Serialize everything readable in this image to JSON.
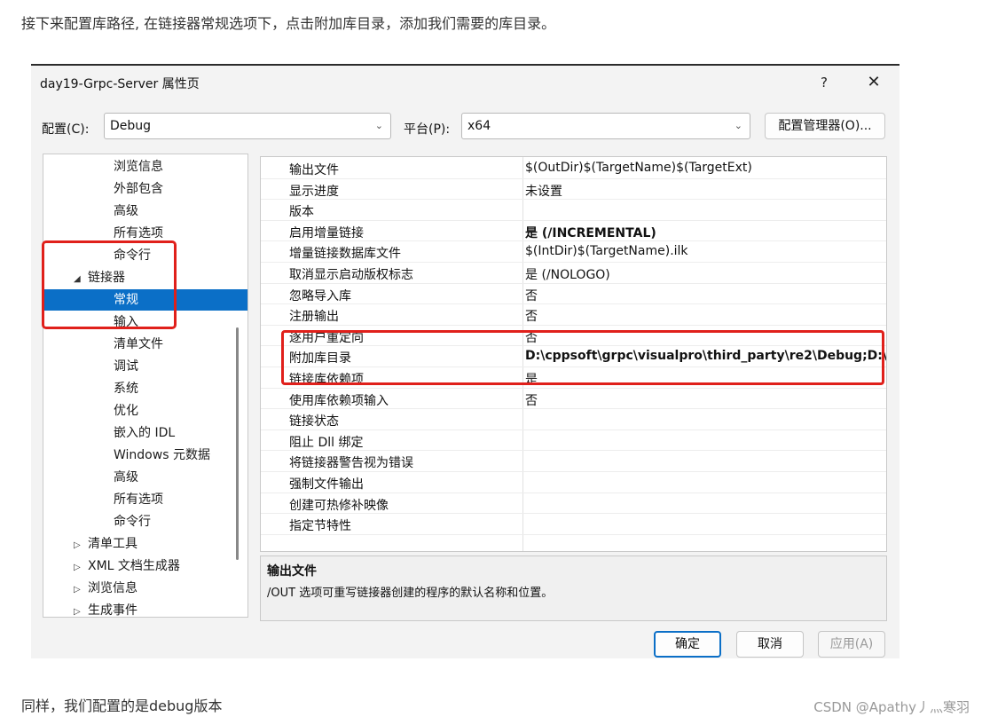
{
  "article": {
    "intro": "接下来配置库路径, 在链接器常规选项下，点击附加库目录，添加我们需要的库目录。",
    "outro": "同样，我们配置的是debug版本",
    "watermark": "CSDN @Apathy丿灬寒羽"
  },
  "dialog": {
    "title": "day19-Grpc-Server 属性页",
    "help": "?",
    "close": "✕",
    "config_label": "配置(C):",
    "config_value": "Debug",
    "platform_label": "平台(P):",
    "platform_value": "x64",
    "manager_button": "配置管理器(O)...",
    "tree": [
      {
        "label": "浏览信息",
        "indent": 2
      },
      {
        "label": "外部包含",
        "indent": 2
      },
      {
        "label": "高级",
        "indent": 2
      },
      {
        "label": "所有选项",
        "indent": 2
      },
      {
        "label": "命令行",
        "indent": 2
      },
      {
        "label": "链接器",
        "indent": 1,
        "arrow": "◢"
      },
      {
        "label": "常规",
        "indent": 2,
        "selected": true
      },
      {
        "label": "输入",
        "indent": 2
      },
      {
        "label": "清单文件",
        "indent": 2
      },
      {
        "label": "调试",
        "indent": 2
      },
      {
        "label": "系统",
        "indent": 2
      },
      {
        "label": "优化",
        "indent": 2
      },
      {
        "label": "嵌入的 IDL",
        "indent": 2
      },
      {
        "label": "Windows 元数据",
        "indent": 2
      },
      {
        "label": "高级",
        "indent": 2
      },
      {
        "label": "所有选项",
        "indent": 2
      },
      {
        "label": "命令行",
        "indent": 2
      },
      {
        "label": "清单工具",
        "indent": 1,
        "arrow": "▷"
      },
      {
        "label": "XML 文档生成器",
        "indent": 1,
        "arrow": "▷"
      },
      {
        "label": "浏览信息",
        "indent": 1,
        "arrow": "▷"
      },
      {
        "label": "生成事件",
        "indent": 1,
        "arrow": "▷"
      }
    ],
    "properties": [
      {
        "name": "输出文件",
        "value": "$(OutDir)$(TargetName)$(TargetExt)"
      },
      {
        "name": "显示进度",
        "value": "未设置"
      },
      {
        "name": "版本",
        "value": ""
      },
      {
        "name": "启用增量链接",
        "value": "是 (/INCREMENTAL)",
        "bold": true
      },
      {
        "name": "增量链接数据库文件",
        "value": "$(IntDir)$(TargetName).ilk"
      },
      {
        "name": "取消显示启动版权标志",
        "value": "是 (/NOLOGO)"
      },
      {
        "name": "忽略导入库",
        "value": "否"
      },
      {
        "name": "注册输出",
        "value": "否"
      },
      {
        "name": "逐用户重定向",
        "value": "否"
      },
      {
        "name": "附加库目录",
        "value": "D:\\cppsoft\\grpc\\visualpro\\third_party\\re2\\Debug;D:\\",
        "bold": true
      },
      {
        "name": "链接库依赖项",
        "value": "是"
      },
      {
        "name": "使用库依赖项输入",
        "value": "否"
      },
      {
        "name": "链接状态",
        "value": ""
      },
      {
        "name": "阻止 Dll 绑定",
        "value": ""
      },
      {
        "name": "将链接器警告视为错误",
        "value": ""
      },
      {
        "name": "强制文件输出",
        "value": ""
      },
      {
        "name": "创建可热修补映像",
        "value": ""
      },
      {
        "name": "指定节特性",
        "value": ""
      }
    ],
    "description": {
      "title": "输出文件",
      "text": "/OUT 选项可重写链接器创建的程序的默认名称和位置。"
    },
    "buttons": {
      "ok": "确定",
      "cancel": "取消",
      "apply": "应用(A)"
    }
  }
}
